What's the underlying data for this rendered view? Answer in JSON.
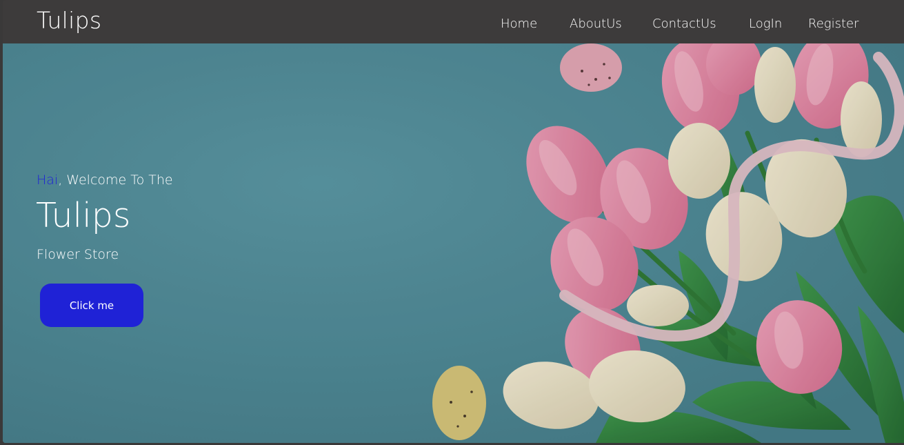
{
  "navbar": {
    "brand": "Tulips",
    "links": [
      "Home",
      "AboutUs",
      "ContactUs",
      "LogIn",
      "Register"
    ]
  },
  "hero": {
    "greeting_accent": "Hai",
    "greeting_rest": ", Welcome To The",
    "title": "Tulips",
    "subtitle": "Flower Store",
    "cta_label": "Click me"
  },
  "colors": {
    "nav_bg": "#3d3b3b",
    "hero_bg": "#4e8e9b",
    "accent": "#1f22d6",
    "text": "#ffffff"
  }
}
